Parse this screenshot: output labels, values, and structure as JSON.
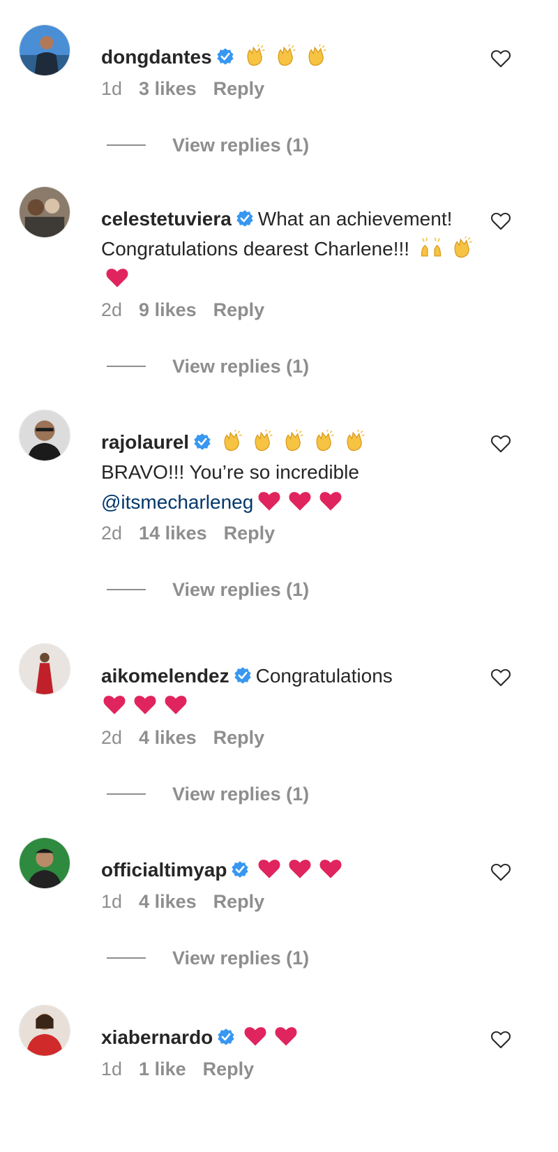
{
  "comments": [
    {
      "username": "dongdantes",
      "text_before": "",
      "mention": "",
      "text_after": "",
      "emojis_line1": [
        "clap",
        "clap",
        "clap"
      ],
      "emojis_line_end": [],
      "time": "1d",
      "likes": "3 likes",
      "reply_label": "Reply",
      "view_replies": "View replies (1)"
    },
    {
      "username": "celestetuviera",
      "text_before": "What an achievement! Congratulations dearest Charlene!!!",
      "mention": "",
      "text_after": "",
      "emojis_line1": [],
      "emojis_line_end": [
        "raised-hands",
        "clap",
        "red-heart"
      ],
      "time": "2d",
      "likes": "9 likes",
      "reply_label": "Reply",
      "view_replies": "View replies (1)"
    },
    {
      "username": "rajolaurel",
      "text_before": "BRAVO!!! You’re so incredible",
      "mention": "@itsmecharleneg",
      "text_after": "",
      "emojis_line1": [
        "clap",
        "clap",
        "clap",
        "clap",
        "clap"
      ],
      "emojis_line_end": [
        "red-heart",
        "red-heart",
        "red-heart"
      ],
      "time": "2d",
      "likes": "14 likes",
      "reply_label": "Reply",
      "view_replies": "View replies (1)"
    },
    {
      "username": "aikomelendez",
      "text_before": "Congratulations",
      "mention": "",
      "text_after": "",
      "emojis_line1": [],
      "emojis_line_end": [
        "red-heart",
        "red-heart",
        "red-heart"
      ],
      "time": "2d",
      "likes": "4 likes",
      "reply_label": "Reply",
      "view_replies": "View replies (1)"
    },
    {
      "username": "officialtimyap",
      "text_before": "",
      "mention": "",
      "text_after": "",
      "emojis_line1": [
        "red-heart",
        "red-heart",
        "red-heart"
      ],
      "emojis_line_end": [],
      "time": "1d",
      "likes": "4 likes",
      "reply_label": "Reply",
      "view_replies": "View replies (1)"
    },
    {
      "username": "xiabernardo",
      "text_before": "",
      "mention": "",
      "text_after": "",
      "emojis_line1": [
        "red-heart",
        "red-heart"
      ],
      "emojis_line_end": [],
      "time": "1d",
      "likes": "1 like",
      "reply_label": "Reply",
      "view_replies": ""
    }
  ],
  "icons": {
    "verified": "verified-badge-icon",
    "like": "heart-outline-icon"
  },
  "colors": {
    "username": "#262626",
    "meta": "#8e8e8e",
    "mention": "#00376b",
    "verified": "#3897f0",
    "heart_emoji": "#e0245e",
    "clap_emoji": "#f6c343"
  }
}
